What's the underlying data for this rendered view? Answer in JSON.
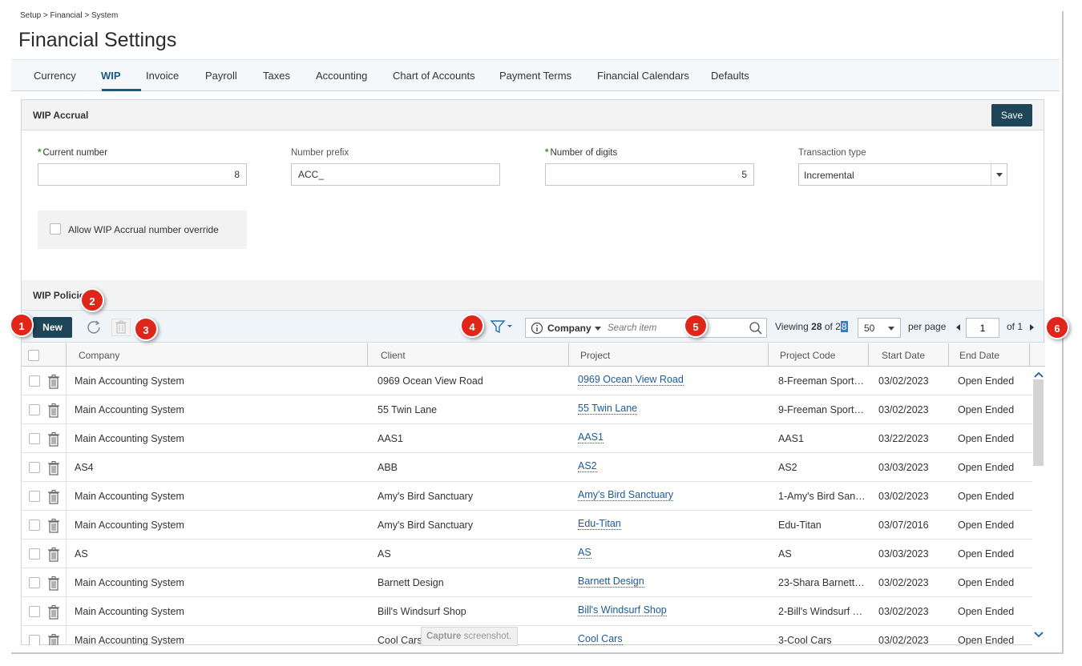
{
  "breadcrumb": "Setup > Financial > System",
  "page_title": "Financial Settings",
  "tabs": [
    {
      "label": "Currency"
    },
    {
      "label": "WIP"
    },
    {
      "label": "Invoice"
    },
    {
      "label": "Payroll"
    },
    {
      "label": "Taxes"
    },
    {
      "label": "Accounting"
    },
    {
      "label": "Chart of Accounts"
    },
    {
      "label": "Payment Terms"
    },
    {
      "label": "Financial Calendars"
    },
    {
      "label": "Defaults"
    }
  ],
  "active_tab": "WIP",
  "wip_accrual": {
    "heading": "WIP Accrual",
    "save_label": "Save",
    "current_number": {
      "label": "Current number",
      "value": "8",
      "required": true
    },
    "number_prefix": {
      "label": "Number prefix",
      "value": "ACC_"
    },
    "number_of_digits": {
      "label": "Number of digits",
      "value": "5",
      "required": true
    },
    "transaction_type": {
      "label": "Transaction type",
      "value": "Incremental"
    },
    "override_label": "Allow WIP Accrual number override",
    "override_checked": false
  },
  "wip_policies": {
    "heading": "WIP Policie",
    "new_label": "New",
    "search": {
      "scope": "Company",
      "placeholder": "Search item"
    },
    "viewing_label": "Viewing",
    "viewing_shown": "28",
    "viewing_of": "of",
    "viewing_total_a": "2",
    "viewing_total_b": "8",
    "per_page_value": "50",
    "per_page_label": "per page",
    "page_value": "1",
    "of_pages": "of 1",
    "columns": [
      "Company",
      "Client",
      "Project",
      "Project Code",
      "Start Date",
      "End Date"
    ],
    "rows": [
      {
        "company": "Main Accounting System",
        "client": "0969 Ocean View Road",
        "project": "0969 Ocean View Road",
        "code": "8-Freeman Sport…",
        "start": "03/02/2023",
        "end": "Open Ended"
      },
      {
        "company": "Main Accounting System",
        "client": "55 Twin Lane",
        "project": "55 Twin Lane",
        "code": "9-Freeman Sport…",
        "start": "03/02/2023",
        "end": "Open Ended"
      },
      {
        "company": "Main Accounting System",
        "client": "AAS1",
        "project": "AAS1",
        "code": "AAS1",
        "start": "03/22/2023",
        "end": "Open Ended"
      },
      {
        "company": "AS4",
        "client": "ABB",
        "project": "AS2",
        "code": "AS2",
        "start": "03/03/2023",
        "end": "Open Ended"
      },
      {
        "company": "Main Accounting System",
        "client": "Amy's Bird Sanctuary",
        "project": "Amy's Bird Sanctuary",
        "code": "1-Amy's Bird San…",
        "start": "03/02/2023",
        "end": "Open Ended"
      },
      {
        "company": "Main Accounting System",
        "client": "Amy's Bird Sanctuary",
        "project": "Edu-Titan",
        "code": "Edu-Titan",
        "start": "03/07/2016",
        "end": "Open Ended"
      },
      {
        "company": "AS",
        "client": "AS",
        "project": "AS",
        "code": "AS",
        "start": "03/03/2023",
        "end": "Open Ended"
      },
      {
        "company": "Main Accounting System",
        "client": "Barnett Design",
        "project": "Barnett Design",
        "code": "23-Shara Barnett…",
        "start": "03/02/2023",
        "end": "Open Ended"
      },
      {
        "company": "Main Accounting System",
        "client": "Bill's Windsurf Shop",
        "project": "Bill's Windsurf Shop",
        "code": "2-Bill's Windsurf …",
        "start": "03/02/2023",
        "end": "Open Ended"
      },
      {
        "company": "Main Accounting System",
        "client": "Cool Cars",
        "project": "Cool Cars",
        "code": "3-Cool Cars",
        "start": "03/02/2023",
        "end": "Open Ended"
      }
    ]
  },
  "callouts": [
    "1",
    "2",
    "3",
    "4",
    "5",
    "6"
  ],
  "capture_tooltip": {
    "bold": "Capture",
    "text": " screenshot."
  },
  "colors": {
    "primary_button": "#1e4558",
    "link": "#1a5a9a",
    "callout": "#e0251b",
    "required_star": "#3d8c2c"
  },
  "icons": [
    "refresh-icon",
    "trash-icon",
    "filter-icon",
    "info-icon",
    "search-icon",
    "chevron-up-icon",
    "chevron-down-icon"
  ]
}
